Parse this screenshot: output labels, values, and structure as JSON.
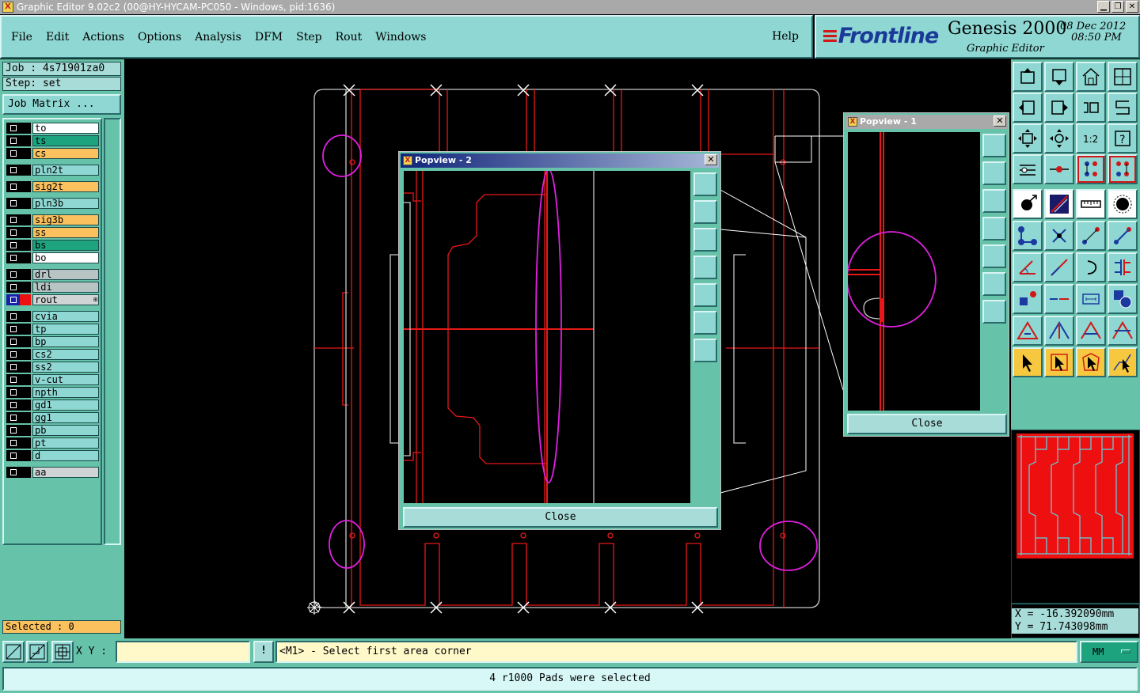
{
  "window": {
    "title": "Graphic Editor 9.02c2 (00@HY-HYCAM-PC050 - Windows, pid:1636)"
  },
  "menu": [
    "File",
    "Edit",
    "Actions",
    "Options",
    "Analysis",
    "DFM",
    "Step",
    "Rout",
    "Windows"
  ],
  "help_label": "Help",
  "logo": {
    "brand": "Frontline",
    "product": "Genesis 2000",
    "subtitle": "Graphic Editor",
    "date": "08 Dec 2012",
    "time": "08:50 PM"
  },
  "job_line": "Job : 4s71901za0",
  "step_line": "Step: set",
  "job_matrix_label": "Job Matrix ...",
  "layers": [
    {
      "name": "to",
      "color": "white"
    },
    {
      "name": "ts",
      "color": "teal"
    },
    {
      "name": "cs",
      "color": "orange"
    },
    {
      "name": "pln2t",
      "color": "cyan"
    },
    {
      "name": "sig2t",
      "color": "orange"
    },
    {
      "name": "pln3b",
      "color": "cyan"
    },
    {
      "name": "sig3b",
      "color": "orange"
    },
    {
      "name": "ss",
      "color": "orange"
    },
    {
      "name": "bs",
      "color": "teal"
    },
    {
      "name": "bo",
      "color": "white"
    },
    {
      "name": "drl",
      "color": "gray"
    },
    {
      "name": "ldi",
      "color": "gray"
    },
    {
      "name": "rout",
      "color": "lgray",
      "active": true
    },
    {
      "name": "cvia",
      "color": "cyan"
    },
    {
      "name": "tp",
      "color": "cyan"
    },
    {
      "name": "bp",
      "color": "cyan"
    },
    {
      "name": "cs2",
      "color": "cyan"
    },
    {
      "name": "ss2",
      "color": "cyan"
    },
    {
      "name": "v-cut",
      "color": "cyan"
    },
    {
      "name": "npth",
      "color": "cyan"
    },
    {
      "name": "gd1",
      "color": "cyan"
    },
    {
      "name": "gg1",
      "color": "cyan"
    },
    {
      "name": "pb",
      "color": "cyan"
    },
    {
      "name": "pt",
      "color": "cyan"
    },
    {
      "name": "d",
      "color": "cyan"
    },
    {
      "name": "aa",
      "color": "lgray"
    }
  ],
  "selected_line": "Selected : 0",
  "popview2": {
    "title": "Popview - 2",
    "close_label": "Close"
  },
  "popview1": {
    "title": "Popview - 1",
    "close_label": "Close"
  },
  "coords": {
    "x": "X = -16.392090mm",
    "y": "Y = 71.743098mm"
  },
  "xy_label": "X Y :",
  "xy_value": "",
  "prompt": "<M1> - Select first area corner",
  "units": "MM",
  "status": "4 r1000 Pads were selected",
  "colors": {
    "panel": "#66c2a8",
    "button": "#8ed7d2",
    "highlight": "#fbc15e",
    "rout": "#ee1010",
    "select_circle": "#e020e0"
  }
}
